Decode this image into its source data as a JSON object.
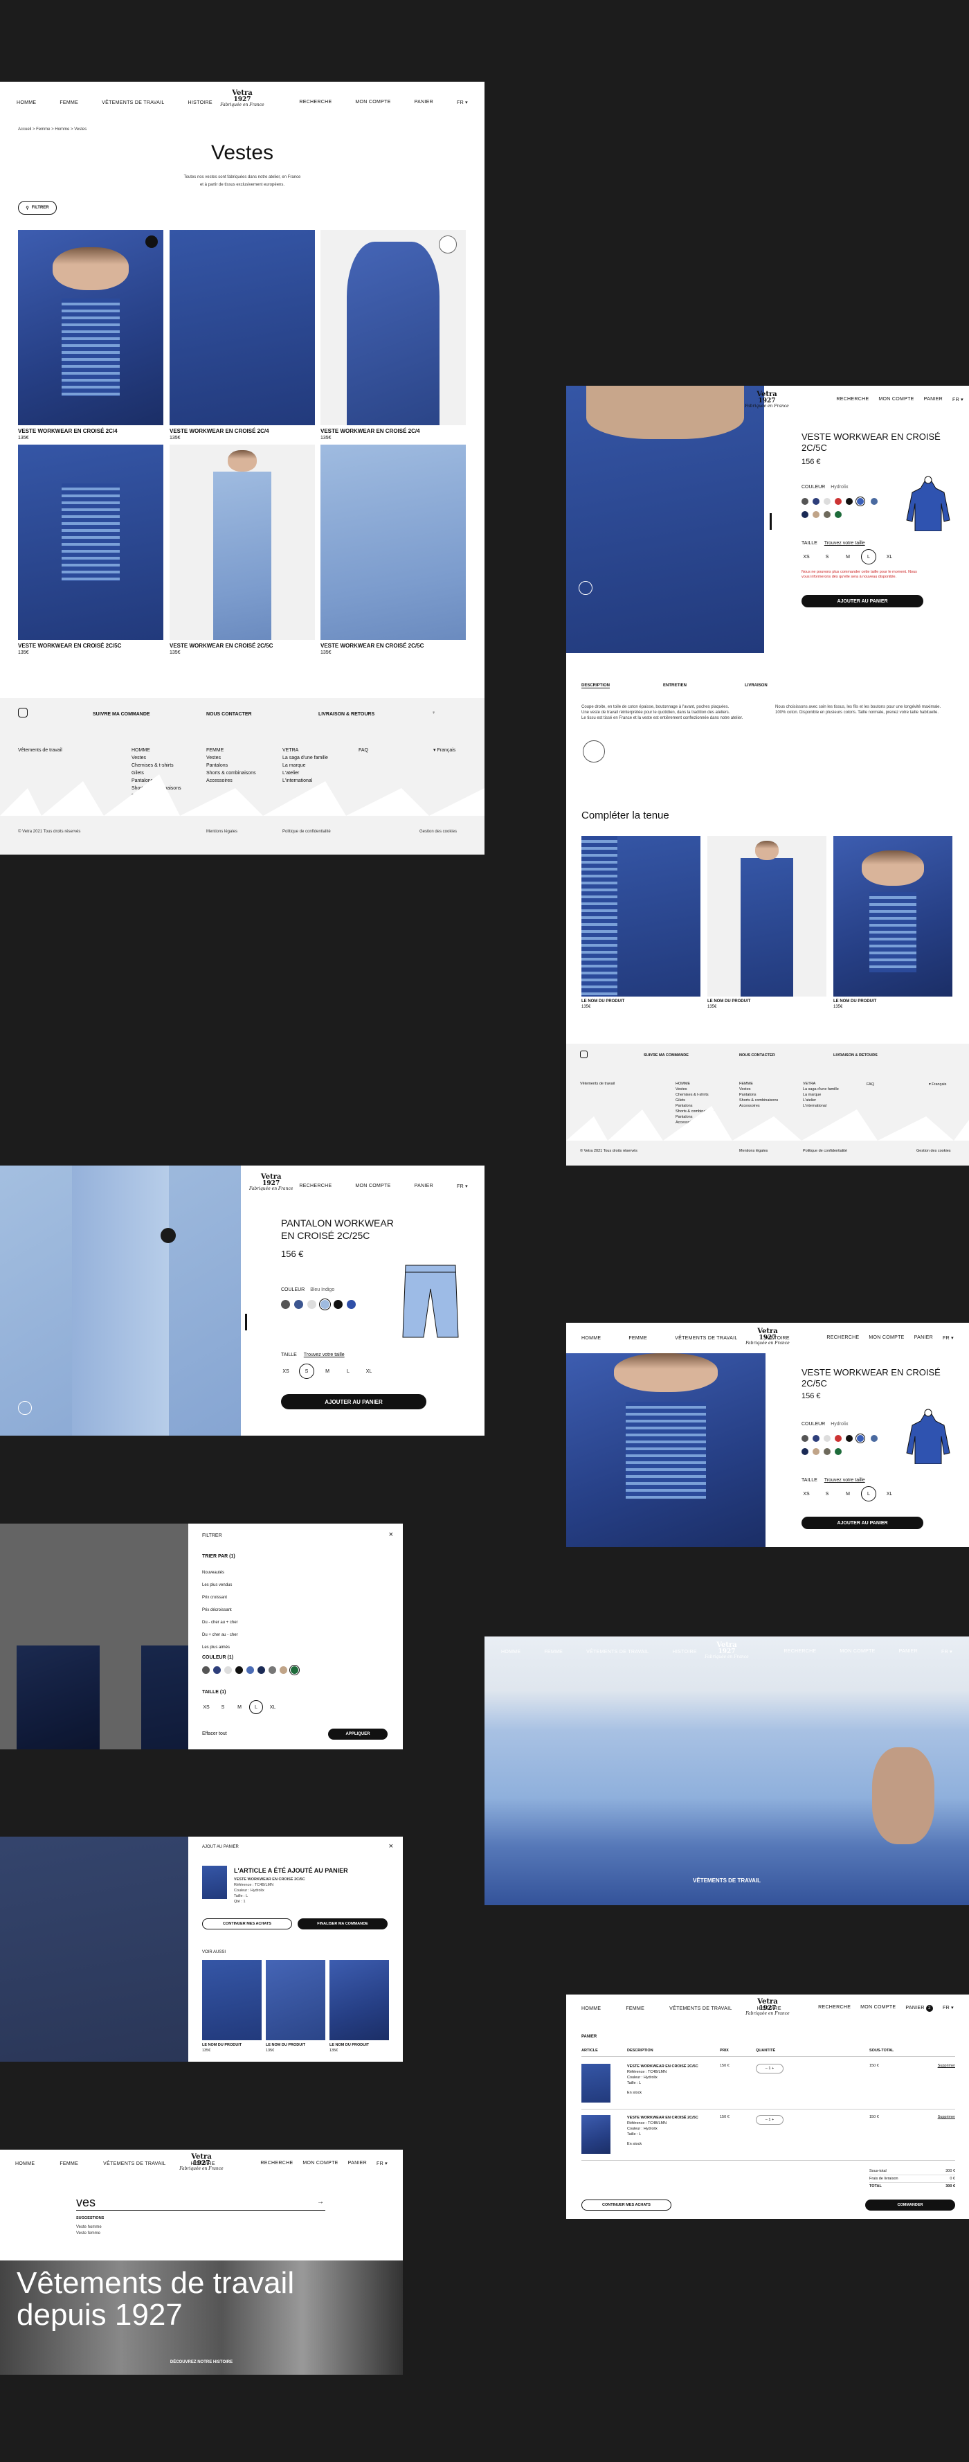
{
  "nav": {
    "homme": "Homme",
    "femme": "Femme",
    "vetements": "Vêtements de travail",
    "histoire": "Histoire",
    "recherche": "Recherche",
    "compte": "Mon compte",
    "panier": "Panier",
    "lang": "FR ▾"
  },
  "logo": {
    "brand": "Vetra",
    "year": "1927",
    "sub": "Fabriquée en France"
  },
  "listing": {
    "breadcrumb": "Accueil > Femme > Homme > Vestes",
    "title": "Vestes",
    "intro_1": "Toutes nos vestes sont fabriquées dans notre atelier, en France",
    "intro_2": "et à partir de tissus exclusivement européens.",
    "filter": "Filtrer",
    "products": [
      {
        "name": "Veste workwear en croisé 2C/4",
        "price": "135€"
      },
      {
        "name": "Veste workwear en croisé 2C/4",
        "price": "135€"
      },
      {
        "name": "Veste workwear en croisé 2C/4",
        "price": "135€"
      },
      {
        "name": "Veste workwear en croisé 2C/5C",
        "price": "135€"
      },
      {
        "name": "Veste workwear en croisé 2C/5C",
        "price": "135€"
      },
      {
        "name": "Veste workwear en croisé 2C/5C",
        "price": "135€"
      }
    ]
  },
  "footer": {
    "suivi": "Suivre ma commande",
    "contact": "Nous contacter",
    "livraison": "Livraison & retours",
    "faq": "FAQ",
    "workwear": "Vêtements de travail",
    "lang": "▾ Français",
    "col_homme": [
      "Homme",
      "Vestes",
      "Chemises & t-shirts",
      "Gilets",
      "Pantalons",
      "Shorts & combinaisons",
      "Pantalons",
      "Accessoires"
    ],
    "col_femme": [
      "Femme",
      "Vestes",
      "Pantalons",
      "Shorts & combinaisons",
      "Accessoires"
    ],
    "col_vetra": [
      "Vetra",
      "La saga d'une famille",
      "La marque",
      "L'atelier",
      "L'international"
    ],
    "copy": "© Vetra 2021 Tous droits réservés",
    "mentions": "Mentions légales",
    "privacy": "Politique de confidentialité",
    "cookies": "Gestion des cookies"
  },
  "jacket": {
    "title_1": "Veste workwear en croisé",
    "title_2": "2C/5C",
    "price": "156 €",
    "couleur": "Couleur",
    "couleur_val": "Hydrolix",
    "taille": "Taille",
    "guide": "Trouvez votre taille",
    "sizes": [
      "XS",
      "S",
      "M",
      "L",
      "XL"
    ],
    "selected_size": "L",
    "warn": "Nous ne pouvons plus commander cette taille pour le moment. Nous vous informerons dès qu'elle sera à nouveau disponible.",
    "add": "Ajouter au panier",
    "tabs": [
      "Description",
      "Entretien",
      "Livraison"
    ],
    "desc_1": "Coupe droite, en toile de coton épaisse, boutonnage à l'avant, poches plaquées.",
    "desc_2": "Une veste de travail réinterprétée pour le quotidien, dans la tradition des ateliers.",
    "desc_3": "Le tissu est tissé en France et la veste est entièrement confectionnée dans notre atelier.",
    "desc_r1": "Nous choisissons avec soin les tissus, les fils et les boutons pour une longévité maximale.",
    "desc_r2": "100% coton. Disponible en plusieurs coloris. Taille normale, prenez votre taille habituelle.",
    "complete": "Compléter la tenue",
    "looks": [
      {
        "name": "Le nom du produit",
        "price": "135€"
      },
      {
        "name": "Le nom du produit",
        "price": "135€"
      },
      {
        "name": "Le nom du produit",
        "price": "135€"
      }
    ]
  },
  "pants": {
    "title_1": "Pantalon workwear",
    "title_2": "en croisé 2C/25C",
    "price": "156 €",
    "couleur": "Couleur",
    "couleur_val": "Bleu Indigo",
    "taille": "Taille",
    "guide": "Trouvez votre taille",
    "sizes": [
      "XS",
      "S",
      "M",
      "L",
      "XL"
    ],
    "selected_size": "S",
    "add": "Ajouter au panier"
  },
  "jacket2": {
    "title_1": "Veste workwear en croisé",
    "title_2": "2C/5C",
    "price": "156 €",
    "couleur": "Couleur",
    "couleur_val": "Hydrolix",
    "taille": "Taille",
    "guide": "Trouvez votre taille",
    "sizes": [
      "XS",
      "S",
      "M",
      "L",
      "XL"
    ],
    "selected_size": "L",
    "add": "Ajouter au panier"
  },
  "filter_panel": {
    "title": "Filtrer",
    "sort": "Trier par (1)",
    "sorts": [
      "Nouveautés",
      "Les plus vendus",
      "Prix croissant",
      "Prix décroissant",
      "Du - cher au + cher",
      "Du + cher au - cher",
      "Les plus aimés"
    ],
    "colors": "Couleur (1)",
    "sizes_h": "Taille (1)",
    "sizes": [
      "XS",
      "S",
      "M",
      "L",
      "XL"
    ],
    "selected_size": "L",
    "clear": "Effacer tout",
    "apply": "Appliquer"
  },
  "hero": {
    "caption": "Vêtements de travail"
  },
  "cart_modal": {
    "header": "Ajout au panier",
    "title": "L'article a été ajouté au panier",
    "item": "Veste workwear en croisé 2C/5C",
    "ref": "Référence : TC4B/LMN",
    "color": "Couleur : Hydrolix",
    "size": "Taille : L",
    "qty": "Qté : 1",
    "continue": "Continuer mes achats",
    "checkout": "Finaliser ma commande",
    "see": "Voir aussi",
    "looks": [
      {
        "name": "Le nom du produit",
        "price": "135€"
      },
      {
        "name": "Le nom du produit",
        "price": "135€"
      },
      {
        "name": "Le nom du produit",
        "price": "135€"
      }
    ]
  },
  "cart": {
    "title": "Panier",
    "col_article": "Article",
    "col_desc": "Description",
    "col_prix": "Prix",
    "col_qty": "Quantité",
    "col_total": "Sous-total",
    "items": [
      {
        "name": "Veste workwear en croisé 2C/5C",
        "ref": "Référence : TC4B/LMN",
        "color": "Couleur : Hydrolix",
        "size": "Taille : L",
        "stock": "En stock",
        "price": "150 €",
        "qty": "1",
        "total": "150 €",
        "remove": "Supprimer"
      },
      {
        "name": "Veste workwear en croisé 2C/5C",
        "ref": "Référence : TC4B/LMN",
        "color": "Couleur : Hydrolix",
        "size": "Taille : L",
        "stock": "En stock",
        "price": "150 €",
        "qty": "1",
        "total": "150 €",
        "remove": "Supprimer"
      }
    ],
    "subtotal_l": "Sous-total",
    "subtotal": "300 €",
    "ship_l": "Frais de livraison",
    "ship": "0 €",
    "total_l": "Total",
    "total": "300 €",
    "continue": "Continuer mes achats",
    "checkout": "Commander",
    "badge": "2"
  },
  "search": {
    "query": "ves",
    "sugg_h": "Suggestions",
    "sugg": [
      "Veste homme",
      "Veste femme"
    ],
    "hero_1": "Vêtements de travail",
    "hero_2": "depuis 1927",
    "hero_cta": "Découvrez notre histoire"
  }
}
